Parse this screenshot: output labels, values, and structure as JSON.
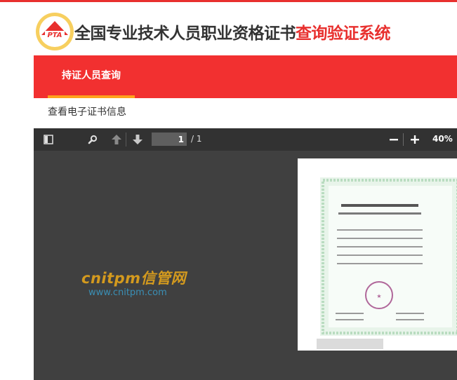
{
  "header": {
    "logo_text": "PTA",
    "title_main": "全国专业技术人员职业资格证书",
    "title_accent": "查询验证系统"
  },
  "nav": {
    "tabs": [
      {
        "label": "持证人员查询",
        "active": true
      }
    ]
  },
  "subtitle": "查看电子证书信息",
  "pdf_viewer": {
    "toolbar": {
      "sidebar_toggle_icon": "sidebar-icon",
      "search_icon": "search-icon",
      "prev_icon": "arrow-up-icon",
      "next_icon": "arrow-down-icon",
      "page_current": "1",
      "page_total": "/ 1",
      "zoom_out_icon": "minus-icon",
      "zoom_in_icon": "plus-icon",
      "zoom": "40%"
    }
  },
  "watermark": {
    "brand": "cnitpm信管网",
    "url": "www.cnitpm.com"
  },
  "colors": {
    "accent_red": "#e8302e",
    "nav_red": "#f23030",
    "tab_underline": "#ffa21c",
    "viewer_bg": "#404040",
    "toolbar_bg": "#323232",
    "watermark_brand": "#d49a1e",
    "watermark_url": "#3a8fb5"
  }
}
